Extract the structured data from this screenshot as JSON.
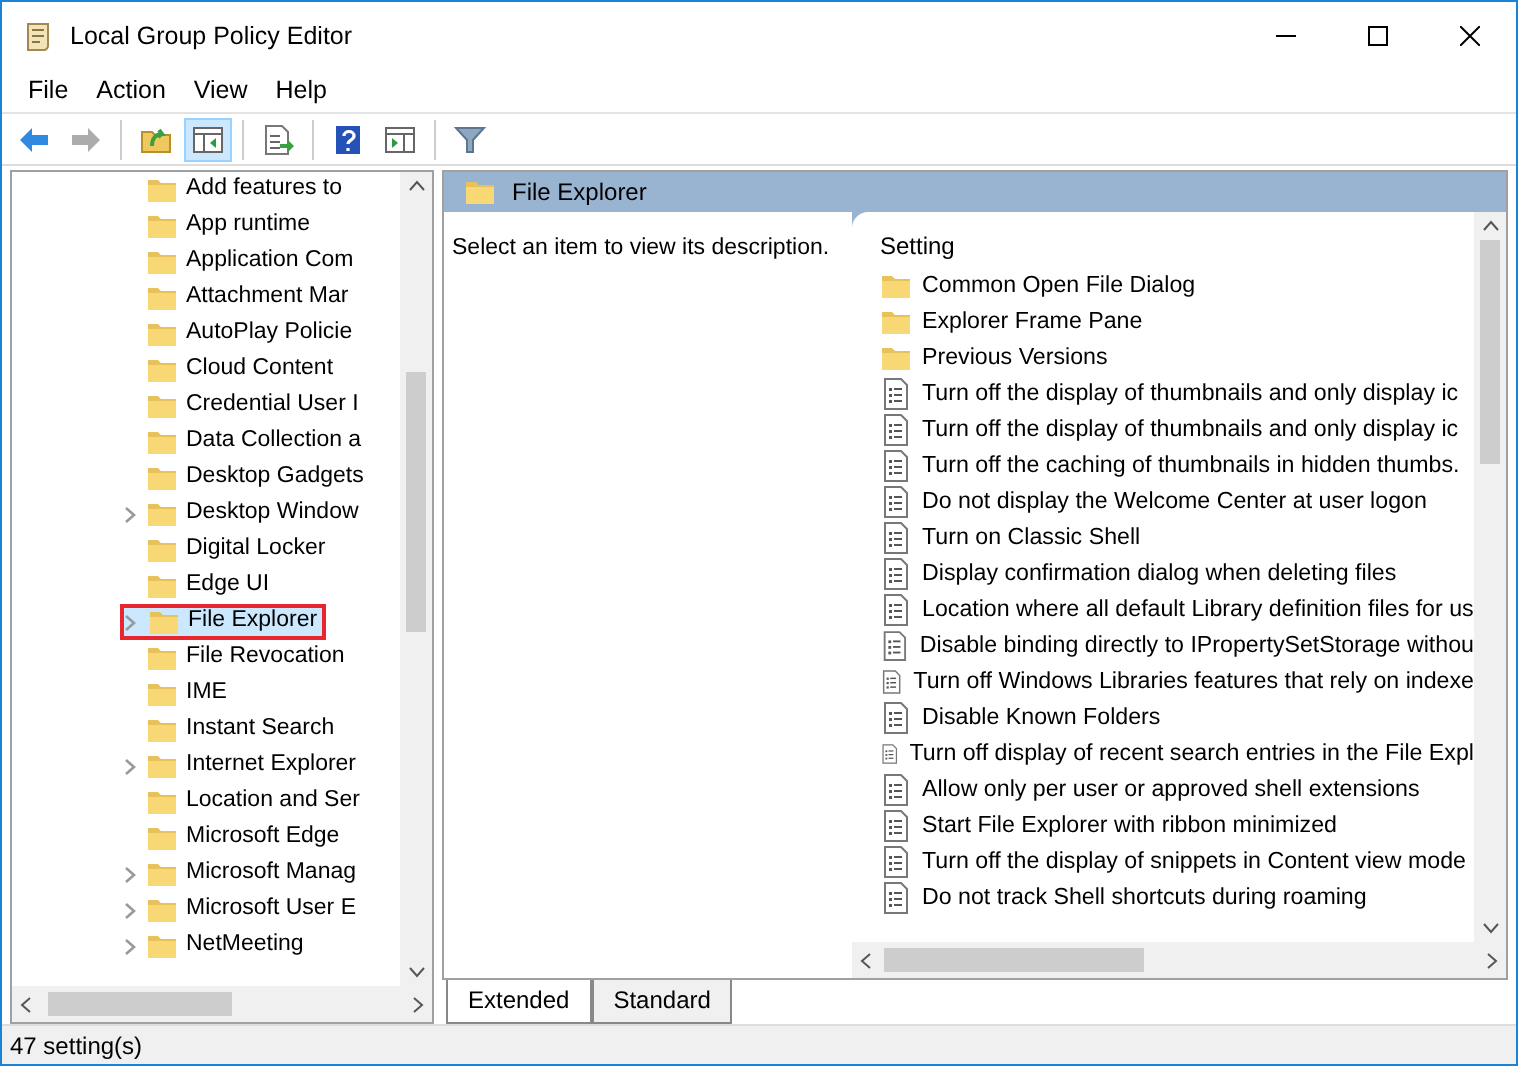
{
  "window": {
    "title": "Local Group Policy Editor"
  },
  "menu": [
    "File",
    "Action",
    "View",
    "Help"
  ],
  "toolbar": [
    {
      "kind": "back",
      "pressed": false,
      "disabled": false
    },
    {
      "kind": "forward",
      "pressed": false,
      "disabled": true
    },
    {
      "kind": "sep"
    },
    {
      "kind": "up",
      "pressed": false,
      "disabled": false
    },
    {
      "kind": "tree",
      "pressed": true,
      "disabled": false
    },
    {
      "kind": "sep"
    },
    {
      "kind": "export",
      "pressed": false,
      "disabled": false
    },
    {
      "kind": "sep"
    },
    {
      "kind": "help",
      "pressed": false,
      "disabled": false
    },
    {
      "kind": "actionpane",
      "pressed": false,
      "disabled": false
    },
    {
      "kind": "sep"
    },
    {
      "kind": "filter",
      "pressed": false,
      "disabled": false
    }
  ],
  "tree": {
    "items": [
      {
        "label": "Add features to",
        "expandable": false,
        "selected": false,
        "highlighted": false
      },
      {
        "label": "App runtime",
        "expandable": false,
        "selected": false,
        "highlighted": false
      },
      {
        "label": "Application Com",
        "expandable": false,
        "selected": false,
        "highlighted": false
      },
      {
        "label": "Attachment Mar",
        "expandable": false,
        "selected": false,
        "highlighted": false
      },
      {
        "label": "AutoPlay Policie",
        "expandable": false,
        "selected": false,
        "highlighted": false
      },
      {
        "label": "Cloud Content",
        "expandable": false,
        "selected": false,
        "highlighted": false
      },
      {
        "label": "Credential User I",
        "expandable": false,
        "selected": false,
        "highlighted": false
      },
      {
        "label": "Data Collection a",
        "expandable": false,
        "selected": false,
        "highlighted": false
      },
      {
        "label": "Desktop Gadgets",
        "expandable": false,
        "selected": false,
        "highlighted": false
      },
      {
        "label": "Desktop Window",
        "expandable": true,
        "selected": false,
        "highlighted": false
      },
      {
        "label": "Digital Locker",
        "expandable": false,
        "selected": false,
        "highlighted": false
      },
      {
        "label": "Edge UI",
        "expandable": false,
        "selected": false,
        "highlighted": false
      },
      {
        "label": "File Explorer",
        "expandable": true,
        "selected": true,
        "highlighted": true
      },
      {
        "label": "File Revocation",
        "expandable": false,
        "selected": false,
        "highlighted": false
      },
      {
        "label": "IME",
        "expandable": false,
        "selected": false,
        "highlighted": false
      },
      {
        "label": "Instant Search",
        "expandable": false,
        "selected": false,
        "highlighted": false
      },
      {
        "label": "Internet Explorer",
        "expandable": true,
        "selected": false,
        "highlighted": false
      },
      {
        "label": "Location and Ser",
        "expandable": false,
        "selected": false,
        "highlighted": false
      },
      {
        "label": "Microsoft Edge",
        "expandable": false,
        "selected": false,
        "highlighted": false
      },
      {
        "label": "Microsoft Manag",
        "expandable": true,
        "selected": false,
        "highlighted": false
      },
      {
        "label": "Microsoft User E",
        "expandable": true,
        "selected": false,
        "highlighted": false
      },
      {
        "label": "NetMeeting",
        "expandable": true,
        "selected": false,
        "highlighted": false
      }
    ]
  },
  "details": {
    "title": "File Explorer",
    "description": "Select an item to view its description.",
    "column": "Setting",
    "rows": [
      {
        "kind": "folder",
        "label": "Common Open File Dialog"
      },
      {
        "kind": "folder",
        "label": "Explorer Frame Pane"
      },
      {
        "kind": "folder",
        "label": "Previous Versions"
      },
      {
        "kind": "policy",
        "label": "Turn off the display of thumbnails and only display ic"
      },
      {
        "kind": "policy",
        "label": "Turn off the display of thumbnails and only display ic"
      },
      {
        "kind": "policy",
        "label": "Turn off the caching of thumbnails in hidden thumbs."
      },
      {
        "kind": "policy",
        "label": "Do not display the Welcome Center at user logon"
      },
      {
        "kind": "policy",
        "label": "Turn on Classic Shell"
      },
      {
        "kind": "policy",
        "label": "Display confirmation dialog when deleting files"
      },
      {
        "kind": "policy",
        "label": "Location where all default Library definition files for us"
      },
      {
        "kind": "policy",
        "label": "Disable binding directly to IPropertySetStorage withou"
      },
      {
        "kind": "policy",
        "label": "Turn off Windows Libraries features that rely on indexe"
      },
      {
        "kind": "policy",
        "label": "Disable Known Folders"
      },
      {
        "kind": "policy",
        "label": "Turn off display of recent search entries in the File Expl"
      },
      {
        "kind": "policy",
        "label": "Allow only per user or approved shell extensions"
      },
      {
        "kind": "policy",
        "label": "Start File Explorer with ribbon minimized"
      },
      {
        "kind": "policy",
        "label": "Turn off the display of snippets in Content view mode"
      },
      {
        "kind": "policy",
        "label": "Do not track Shell shortcuts during roaming"
      }
    ]
  },
  "tabs": [
    {
      "label": "Extended",
      "selected": true
    },
    {
      "label": "Standard",
      "selected": false
    }
  ],
  "status_bar": "47 setting(s)"
}
